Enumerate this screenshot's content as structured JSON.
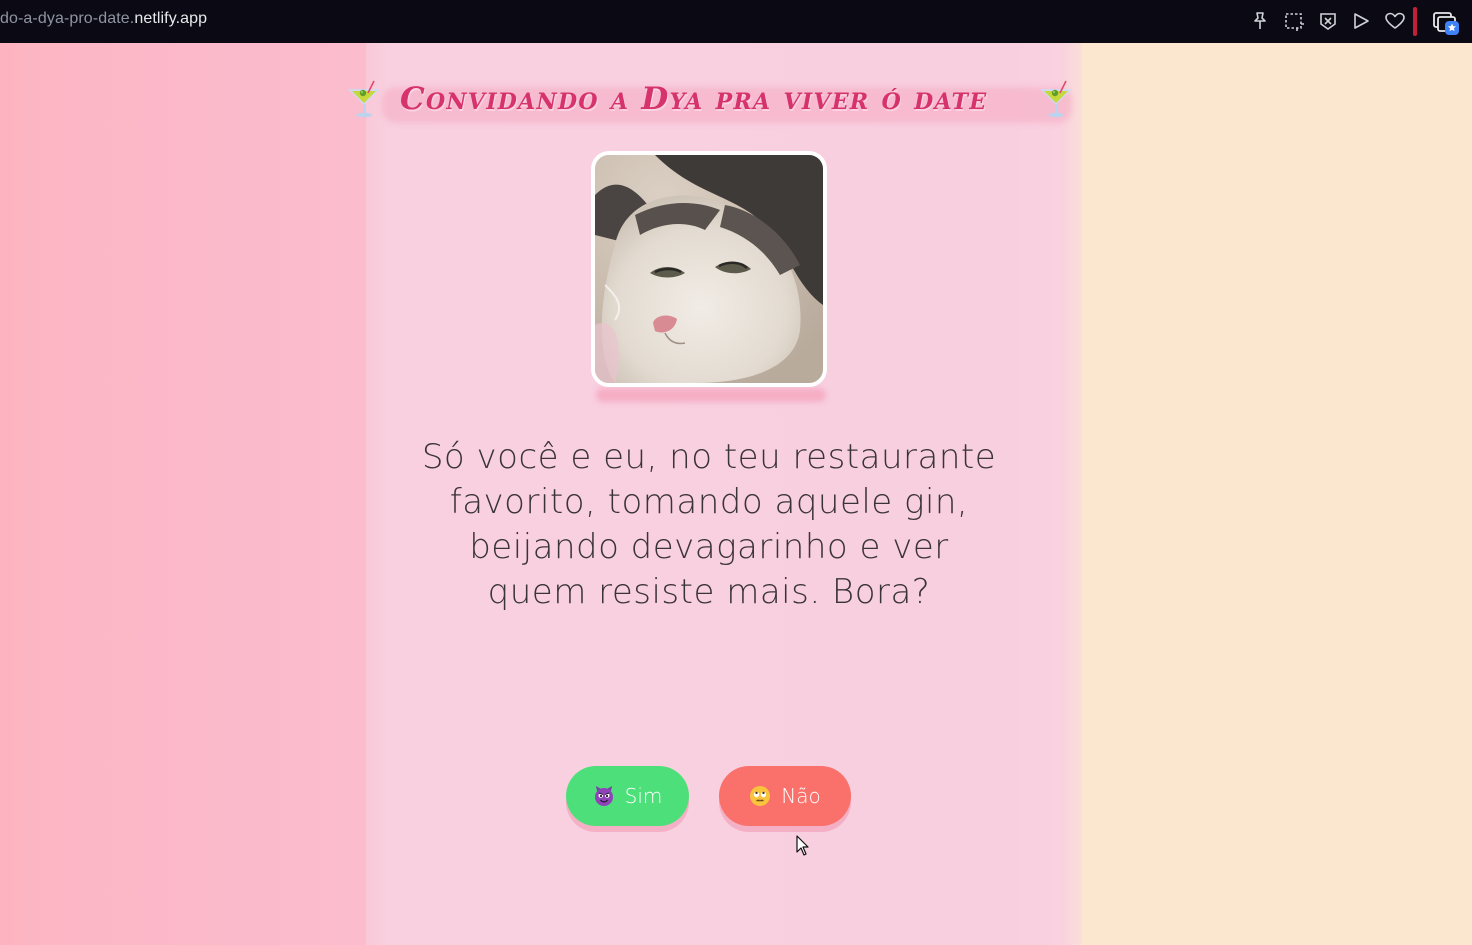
{
  "browser": {
    "url_prefix": "do-a-dya-pro-date.",
    "url_domain": "netlify.app",
    "toolbar_icons": [
      "pin-icon",
      "screenshot-icon",
      "close-tab-icon",
      "play-icon",
      "heart-icon",
      "tabs-icon"
    ],
    "accent_color": "#c2203a"
  },
  "page": {
    "title": "Convidando a Dya pra viver ó date",
    "title_icon": "cocktail-icon",
    "photo": "cat-photo",
    "message": "Só você e eu, no teu restaurante favorito, tomando aquele gin, beijando devagarinho e ver quem resiste mais. Bora?",
    "buttons": {
      "yes": {
        "label": "Sim",
        "icon": "devil-emoji-icon",
        "color": "#4ddf7a"
      },
      "no": {
        "label": "Não",
        "icon": "eye-roll-emoji-icon",
        "color": "#fa706a"
      }
    }
  },
  "colors": {
    "title": "#d6336c",
    "background_main": "#f8cfdf",
    "background_right": "#fbe6cf",
    "background_left": "#fcb6c4"
  }
}
